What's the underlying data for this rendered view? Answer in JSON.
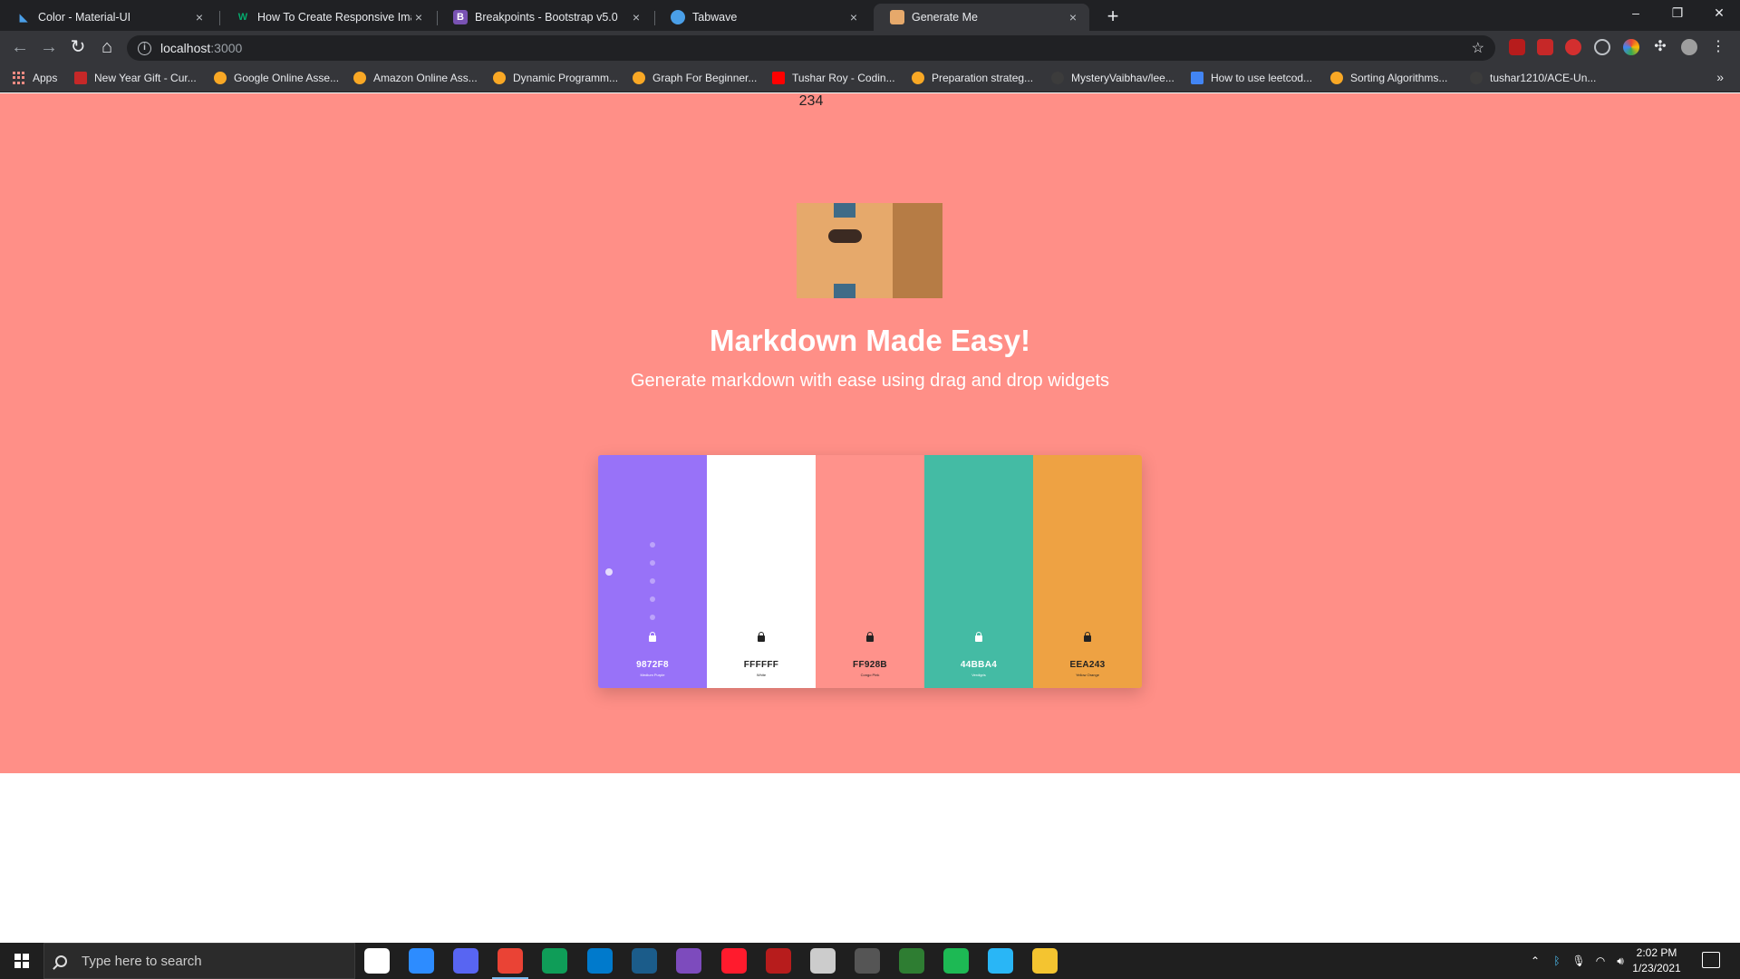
{
  "browser": {
    "tabs": [
      {
        "title": "Color - Material-UI",
        "favicon_color": "#4a9fe8",
        "active": false
      },
      {
        "title": "How To Create Responsive Image",
        "favicon_color": "#04aa6d",
        "active": false
      },
      {
        "title": "Breakpoints - Bootstrap v5.0",
        "favicon_color": "#7952b3",
        "favicon_letter": "B",
        "active": false
      },
      {
        "title": "Tabwave",
        "favicon_color": "#4a9fe8",
        "active": false
      },
      {
        "title": "Generate Me",
        "favicon_color": "#e6a96b",
        "active": true
      }
    ],
    "close_glyph": "×",
    "newtab_glyph": "+",
    "window_controls": {
      "minimize": "–",
      "restore": "❐",
      "close": "✕"
    },
    "address": {
      "host": "localhost",
      "port": ":3000"
    },
    "bookmarks": [
      {
        "label": "Apps",
        "icon": "apps-grid"
      },
      {
        "label": "New Year Gift - Cur...",
        "icon_color": "#c62828"
      },
      {
        "label": "Google Online Asse...",
        "icon_color": "#f9a825"
      },
      {
        "label": "Amazon Online Ass...",
        "icon_color": "#f9a825"
      },
      {
        "label": "Dynamic Programm...",
        "icon_color": "#f9a825"
      },
      {
        "label": "Graph For Beginner...",
        "icon_color": "#f9a825"
      },
      {
        "label": "Tushar Roy - Codin...",
        "icon_color": "#ff0000"
      },
      {
        "label": "Preparation strateg...",
        "icon_color": "#f9a825"
      },
      {
        "label": "MysteryVaibhav/lee...",
        "icon_color": "#3c3c3c"
      },
      {
        "label": "How to use leetcod...",
        "icon_color": "#4285f4"
      },
      {
        "label": "Sorting Algorithms...",
        "icon_color": "#f9a825"
      },
      {
        "label": "tushar1210/ACE-Un...",
        "icon_color": "#3c3c3c"
      }
    ],
    "bookmarks_more": "»"
  },
  "page": {
    "counter": "234",
    "title": "Markdown Made Easy!",
    "subtitle": "Generate markdown with ease using drag and drop widgets",
    "background": "#ff8f87",
    "palette": [
      {
        "hex": "9872F8",
        "color": "#9872f8",
        "text_color": "#ffffff",
        "name": "Medium Purple"
      },
      {
        "hex": "FFFFFF",
        "color": "#ffffff",
        "text_color": "#222222",
        "name": "White"
      },
      {
        "hex": "FF928B",
        "color": "#ff928b",
        "text_color": "#222222",
        "name": "Congo Pink"
      },
      {
        "hex": "44BBA4",
        "color": "#44bba4",
        "text_color": "#ffffff",
        "name": "Verdigris"
      },
      {
        "hex": "EEA243",
        "color": "#eea243",
        "text_color": "#222222",
        "name": "Yellow Orange"
      }
    ]
  },
  "taskbar": {
    "search_placeholder": "Type here to search",
    "time": "2:02 PM",
    "date": "1/23/2021",
    "apps": [
      {
        "name": "task-view",
        "color": "#ffffff"
      },
      {
        "name": "zoom",
        "color": "#2d8cff"
      },
      {
        "name": "discord-badge",
        "color": "#5865f2"
      },
      {
        "name": "chrome",
        "color": "#ea4335"
      },
      {
        "name": "edge",
        "color": "#0f9d58"
      },
      {
        "name": "vscode",
        "color": "#007acc"
      },
      {
        "name": "steam",
        "color": "#1b5c8a"
      },
      {
        "name": "app-purple",
        "color": "#7d4bbd"
      },
      {
        "name": "opera",
        "color": "#ff1b2d"
      },
      {
        "name": "app-red",
        "color": "#b71c1c"
      },
      {
        "name": "app-unity",
        "color": "#cccccc"
      },
      {
        "name": "obs",
        "color": "#555555"
      },
      {
        "name": "app-headset",
        "color": "#2e7d32"
      },
      {
        "name": "spotify",
        "color": "#1db954"
      },
      {
        "name": "app-drop",
        "color": "#29b6f6"
      },
      {
        "name": "file-explorer",
        "color": "#f4c430"
      }
    ]
  }
}
